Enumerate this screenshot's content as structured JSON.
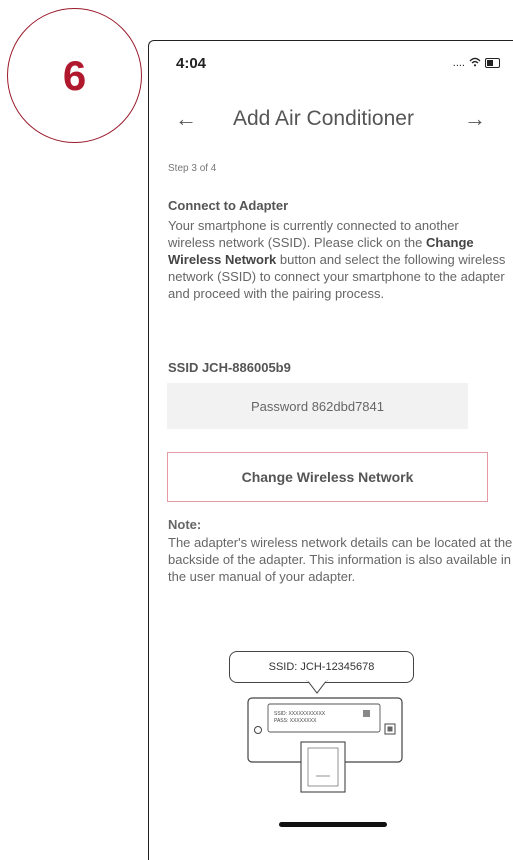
{
  "step_badge": {
    "number": "6"
  },
  "status_bar": {
    "time": "4:04",
    "signal": "...."
  },
  "nav": {
    "title": "Add Air Conditioner",
    "back_glyph": "←",
    "forward_glyph": "→"
  },
  "step_indicator": "Step 3 of 4",
  "connect": {
    "title": "Connect to Adapter",
    "text_before": "Your smartphone is currently connected to another wireless network (SSID). Please click on the ",
    "text_bold": "Change Wireless Network",
    "text_after": " button and select the following wireless network (SSID) to connect your smartphone to the adapter and proceed with the pairing process."
  },
  "ssid": "SSID JCH-886005b9",
  "password": "Password 862dbd7841",
  "change_button_label": "Change Wireless Network",
  "note": {
    "title": "Note:",
    "text": "The adapter's wireless network details can be located at the backside of the adapter. This information is also available in the user manual of your adapter."
  },
  "illustration": {
    "bubble_text": "SSID: JCH-12345678",
    "label_line1": "SSID: XXXXXXXXXXX",
    "label_line2": "PASS: XXXXXXXX"
  },
  "colors": {
    "badge_accent": "#b0182e",
    "button_border": "#e59aa4"
  }
}
